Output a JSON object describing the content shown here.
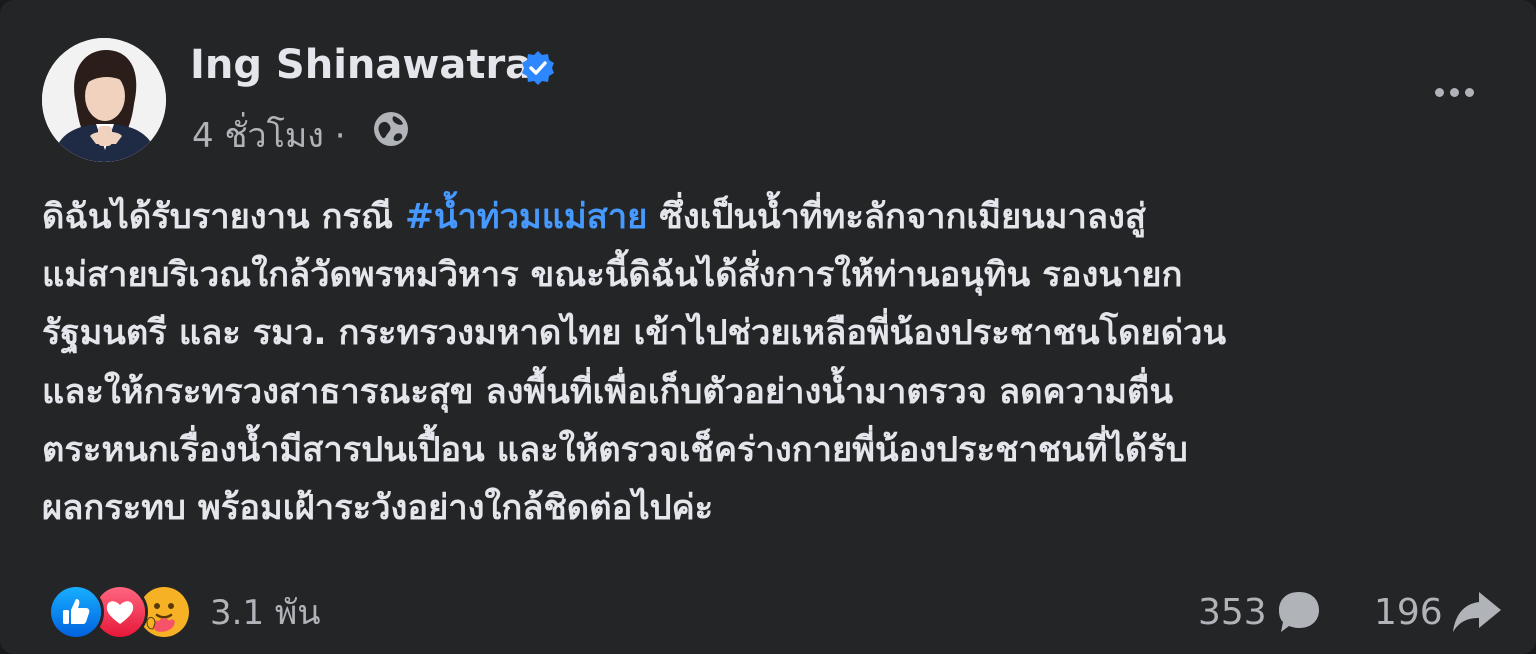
{
  "post": {
    "author": "Ing Shinawatra",
    "timestamp": "4 ชั่วโมง ·",
    "body": {
      "line1_before": "ดิฉันได้รับรายงาน กรณี ",
      "hashtag": "#น้ำท่วมแม่สาย",
      "line1_after": " ซึ่งเป็นน้ำที่ทะลักจากเมียนมาลงสู่",
      "line2": "แม่สายบริเวณใกล้วัดพรหมวิหาร ขณะนี้ดิฉันได้สั่งการให้ท่านอนุทิน รองนายก",
      "line3": "รัฐมนตรี และ รมว. กระทรวงมหาดไทย เข้าไปช่วยเหลือพี่น้องประชาชนโดยด่วน",
      "line4": "และให้กระทรวงสาธารณะสุข ลงพื้นที่เพื่อเก็บตัวอย่างน้ำมาตรวจ ลดความตื่น",
      "line5": "ตระหนกเรื่องน้ำมีสารปนเปื้อน และให้ตรวจเช็คร่างกายพี่น้องประชาชนที่ได้รับ",
      "line6": "ผลกระทบ พร้อมเฝ้าระวังอย่างใกล้ชิดต่อไปค่ะ"
    },
    "reactions": {
      "icons": [
        "like-icon",
        "love-icon",
        "care-icon"
      ],
      "count": "3.1 พัน"
    },
    "comments_count": "353",
    "shares_count": "196"
  },
  "colors": {
    "background": "#242526",
    "text": "#e4e6eb",
    "secondary_text": "#b0b3b8",
    "hashtag": "#4599ff",
    "verified_badge": "#2d88ff"
  }
}
